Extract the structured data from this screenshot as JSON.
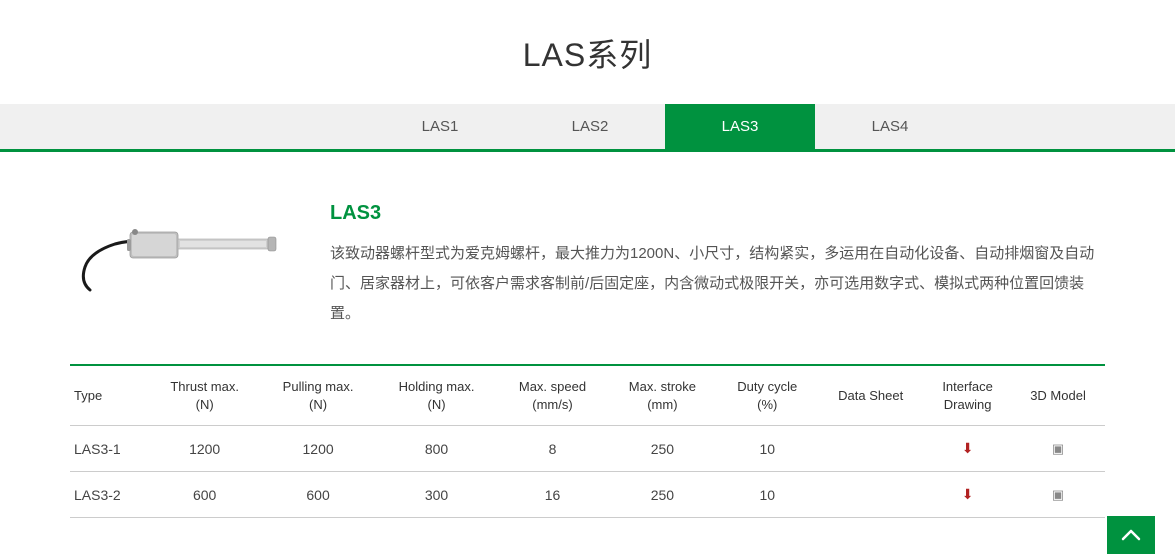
{
  "page_title": "LAS系列",
  "tabs": [
    {
      "label": "LAS1",
      "active": false
    },
    {
      "label": "LAS2",
      "active": false
    },
    {
      "label": "LAS3",
      "active": true
    },
    {
      "label": "LAS4",
      "active": false
    }
  ],
  "detail": {
    "title": "LAS3",
    "description": "该致动器螺杆型式为爱克姆螺杆，最大推力为1200N、小尺寸，结构紧实，多运用在自动化设备、自动排烟窗及自动门、居家器材上，可依客户需求客制前/后固定座，内含微动式极限开关，亦可选用数字式、模拟式两种位置回馈装置。"
  },
  "table": {
    "headers": [
      "Type",
      "Thrust max. (N)",
      "Pulling max. (N)",
      "Holding max. (N)",
      "Max. speed (mm/s)",
      "Max. stroke (mm)",
      "Duty cycle (%)",
      "Data Sheet",
      "Interface Drawing",
      "3D Model"
    ],
    "rows": [
      {
        "type": "LAS3-1",
        "thrust": "1200",
        "pulling": "1200",
        "holding": "800",
        "speed": "8",
        "stroke": "250",
        "duty": "10"
      },
      {
        "type": "LAS3-2",
        "thrust": "600",
        "pulling": "600",
        "holding": "300",
        "speed": "16",
        "stroke": "250",
        "duty": "10"
      }
    ]
  },
  "icons": {
    "pdf": "pdf-icon",
    "model": "3d-model-icon",
    "chevron_up": "chevron-up-icon"
  }
}
